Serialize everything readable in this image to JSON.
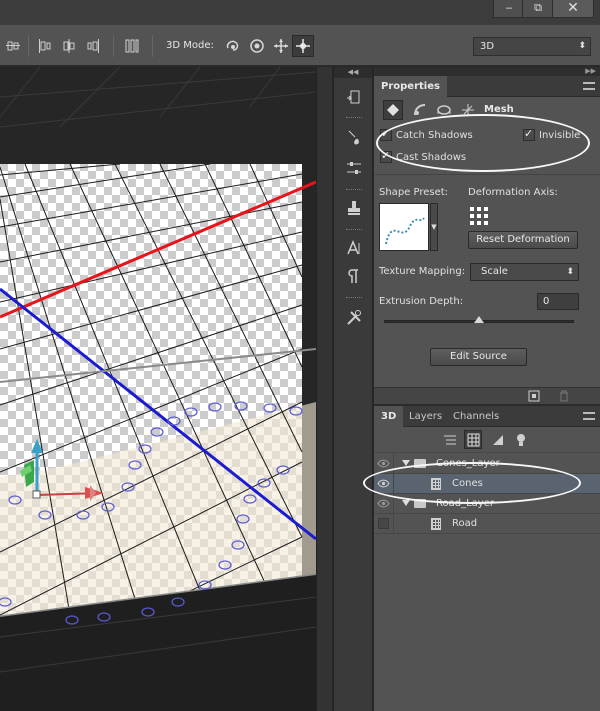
{
  "window": {
    "minimize_glyph": "‒",
    "restore_glyph": "⧉",
    "close_glyph": "✕"
  },
  "options_bar": {
    "mode_label": "3D Mode:",
    "workspace_value": "3D",
    "tools": [
      "align-left-icon",
      "align-center-icon",
      "align-right-icon",
      "distribute-icon",
      "rotate-3d-icon",
      "roll-3d-icon",
      "drag-3d-icon",
      "slide-3d-icon"
    ]
  },
  "toolstrip": {
    "tools": [
      "history-icon",
      "brush-presets-icon",
      "adjustments-icon",
      "stamp-icon",
      "character-icon",
      "paragraph-icon",
      "tools-icon"
    ]
  },
  "properties": {
    "tab_label": "Properties",
    "mode_label": "Mesh",
    "catch_shadows": {
      "label": "Catch Shadows",
      "checked": true
    },
    "invisible": {
      "label": "Invisible",
      "checked": true
    },
    "cast_shadows": {
      "label": "Cast Shadows",
      "checked": true
    },
    "shape_preset_label": "Shape Preset:",
    "deformation_axis_label": "Deformation Axis:",
    "reset_deformation_label": "Reset Deformation",
    "texture_mapping_label": "Texture Mapping:",
    "texture_mapping_value": "Scale",
    "extrusion_depth_label": "Extrusion Depth:",
    "extrusion_depth_value": "0",
    "extrusion_slider_fraction": 0.5,
    "edit_source_label": "Edit Source"
  },
  "layers_panel": {
    "tabs": [
      {
        "label": "3D",
        "active": true
      },
      {
        "label": "Layers",
        "active": false
      },
      {
        "label": "Channels",
        "active": false
      }
    ],
    "rows": [
      {
        "name": "Cones_Layer",
        "kind": "group",
        "visible": true,
        "selected": false
      },
      {
        "name": "Cones",
        "kind": "mesh",
        "visible": true,
        "selected": true
      },
      {
        "name": "Road_Layer",
        "kind": "group",
        "visible": true,
        "selected": false
      },
      {
        "name": "Road",
        "kind": "mesh",
        "visible": false,
        "selected": false
      }
    ]
  },
  "colors": {
    "x_axis": "#e8141c",
    "z_axis": "#1b1bd0",
    "highlight": "#ffffff"
  }
}
